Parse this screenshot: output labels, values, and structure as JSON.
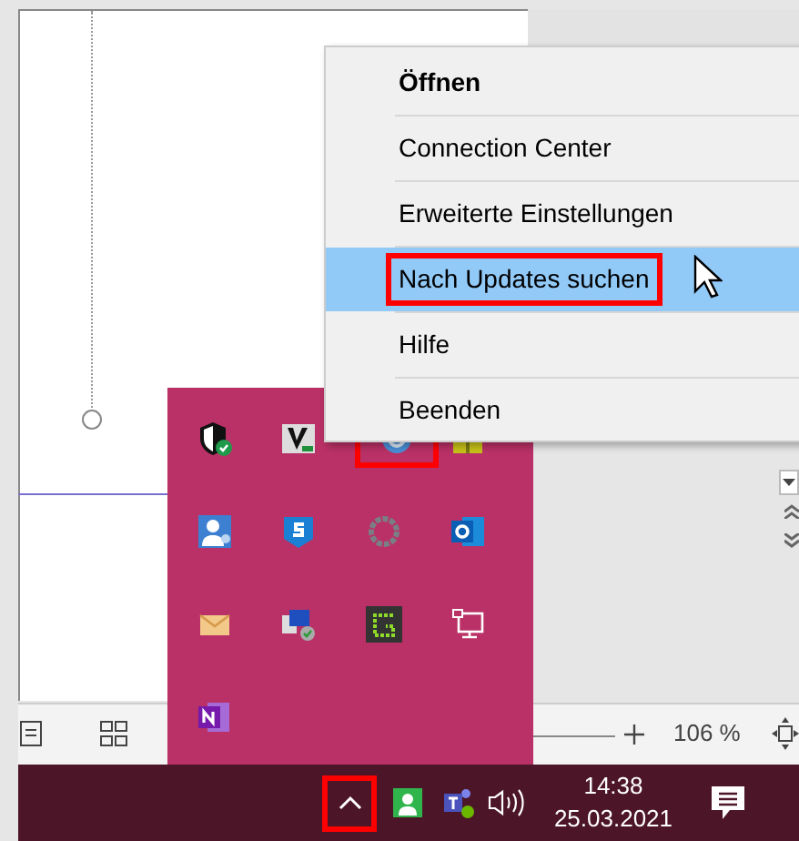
{
  "context_menu": {
    "items": [
      {
        "label": "Öffnen",
        "default": true,
        "selected": false,
        "outlined": false
      },
      {
        "label": "Connection Center",
        "default": false,
        "selected": false,
        "outlined": false
      },
      {
        "label": "Erweiterte Einstellungen",
        "default": false,
        "selected": false,
        "outlined": false
      },
      {
        "label": "Nach Updates suchen",
        "default": false,
        "selected": true,
        "outlined": true
      },
      {
        "label": "Hilfe",
        "default": false,
        "selected": false,
        "outlined": false
      },
      {
        "label": "Beenden",
        "default": false,
        "selected": false,
        "outlined": false
      }
    ]
  },
  "tray_flyout": {
    "icons": [
      {
        "kind": "shield",
        "outlined": false
      },
      {
        "kind": "vim",
        "outlined": false
      },
      {
        "kind": "receiver",
        "outlined": true
      },
      {
        "kind": "yellow",
        "outlined": false
      },
      {
        "kind": "people",
        "outlined": false
      },
      {
        "kind": "sophos",
        "outlined": false
      },
      {
        "kind": "ring",
        "outlined": false
      },
      {
        "kind": "outlook",
        "outlined": false
      },
      {
        "kind": "mail",
        "outlined": false
      },
      {
        "kind": "network",
        "outlined": false
      },
      {
        "kind": "greenshot",
        "outlined": false
      },
      {
        "kind": "monitor",
        "outlined": false
      },
      {
        "kind": "onenote",
        "outlined": false
      }
    ]
  },
  "status_bar": {
    "zoom": "106 %"
  },
  "taskbar": {
    "overflow_outlined": true,
    "time": "14:38",
    "date": "25.03.2021"
  }
}
